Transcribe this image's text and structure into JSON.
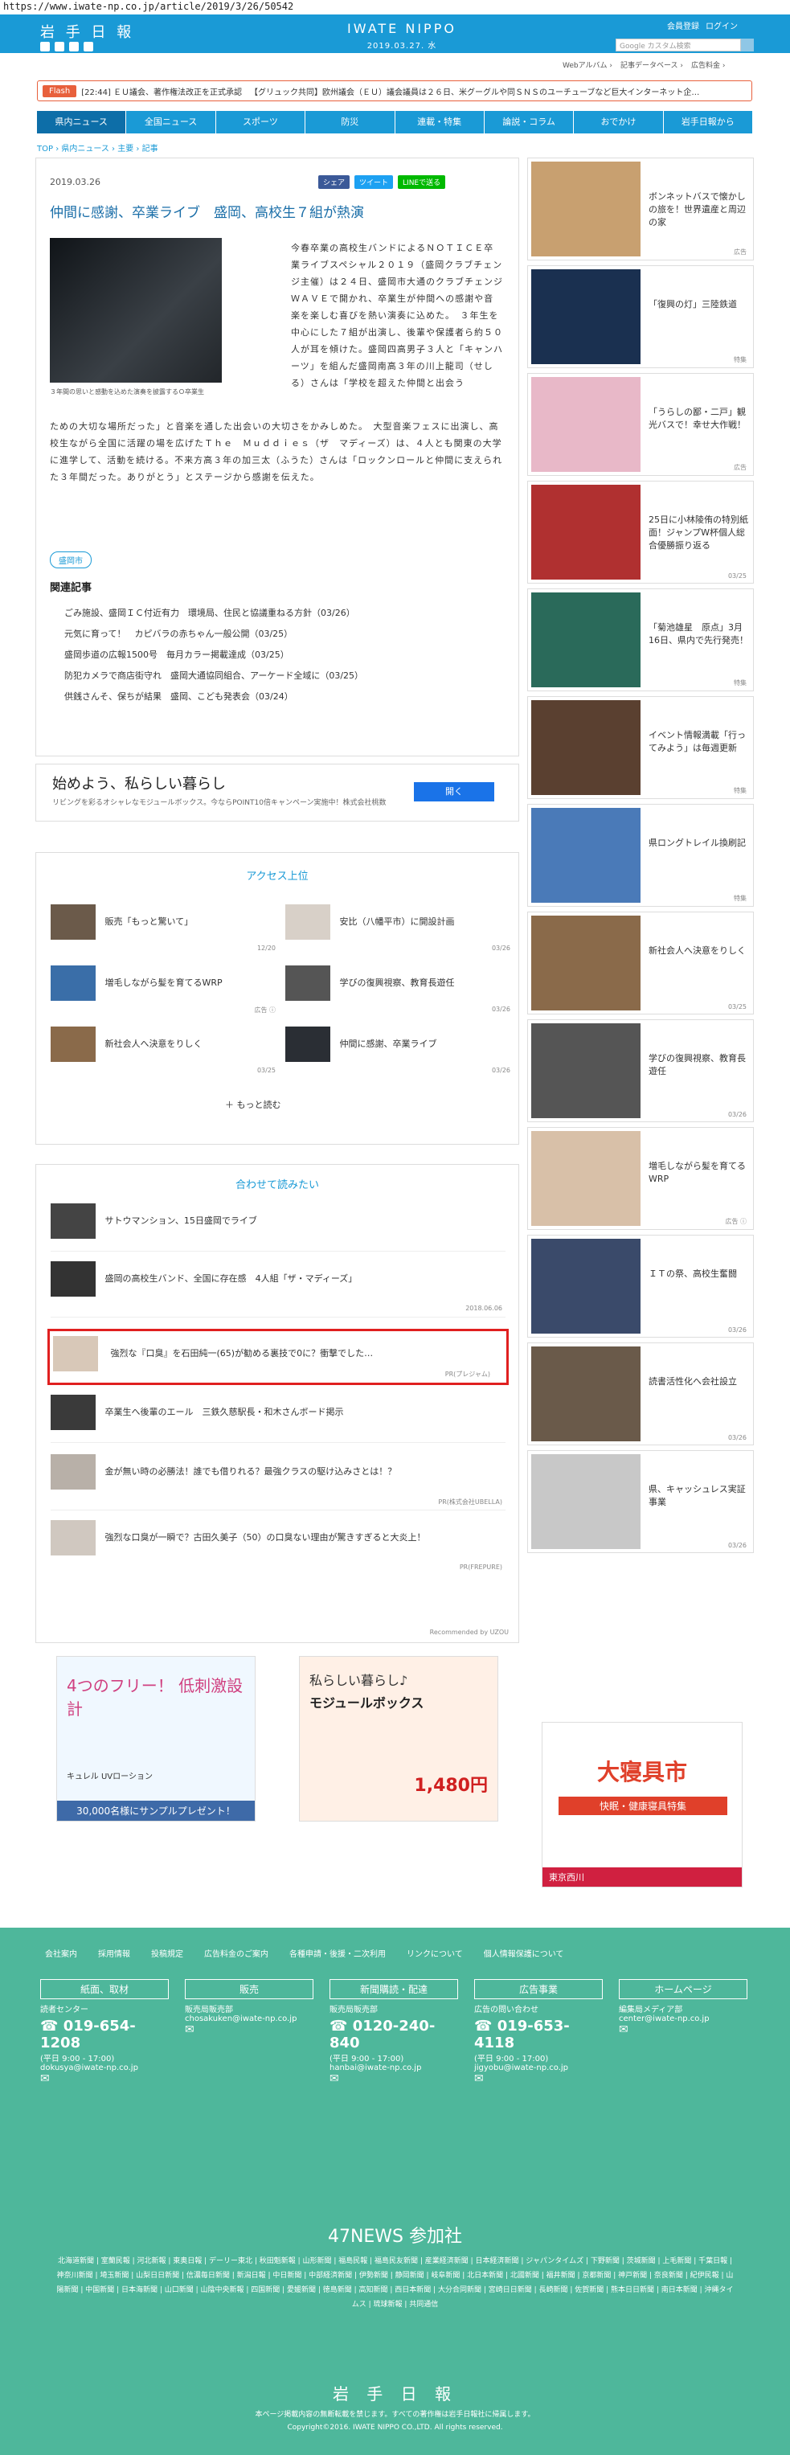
{
  "url": "https://www.iwate-np.co.jp/article/2019/3/26/50542",
  "header": {
    "logo": "岩 手 日 報",
    "brand": "IWATE NIPPO",
    "date": "2019.03.27. 水",
    "links": [
      "会員登録",
      "ログイン"
    ],
    "search_placeholder": "Google カスタム検索",
    "sublinks": [
      "Webアルバム ›",
      "記事データベース ›",
      "広告料金 ›"
    ]
  },
  "flash": {
    "label": "Flash",
    "items": [
      "[22:44] ＥＵ議会、著作権法改正を正式承認",
      "【グリュック共同】欧州議会（ＥＵ）議会議員は２６日、米グーグルや同ＳＮＳのユーチューブなど巨大インターネット企…"
    ]
  },
  "nav": [
    "県内ニュース",
    "全国ニュース",
    "スポーツ",
    "防災",
    "連載・特集",
    "論説・コラム",
    "おでかけ",
    "岩手日報から"
  ],
  "breadcrumb": "TOP › 県内ニュース › 主要 › 記事",
  "article": {
    "date": "2019.03.26",
    "share": [
      "シェア",
      "ツイート",
      "LINEで送る"
    ],
    "title": "仲間に感謝、卒業ライブ　盛岡、高校生７組が熱演",
    "caption": "３年間の思いと感動を込めた演奏を披露するＯ卒業生",
    "body1": "今春卒業の高校生バンドによるＮＯＴＩＣＥ卒業ライブスペシャル２０１９（盛岡クラブチェンジ主催）は２４日、盛岡市大通のクラブチェンジＷＡＶＥで開かれ、卒業生が仲間への感謝や音楽を楽しむ喜びを熱い演奏に込めた。　３年生を中心にした７組が出演し、後輩や保護者ら約５０人が耳を傾けた。盛岡四高男子３人と「キャンハーツ」を組んだ盛岡南高３年の川上龍司（せしる）さんは「学校を超えた仲間と出会う",
    "body2": "ための大切な場所だった」と音楽を通した出会いの大切さをかみしめた。　大型音楽フェスに出演し、高校生ながら全国に活躍の場を広げたＴｈｅ　Ｍｕｄｄｉｅｓ（ザ　マディーズ）は、４人とも関東の大学に進学して、活動を続ける。不来方高３年の加三太（ふうた）さんは「ロックンロールと仲間に支えられた３年間だった。ありがとう」とステージから感謝を伝えた。",
    "tag": "盛岡市",
    "related_heading": "関連記事",
    "related": [
      "ごみ施設、盛岡ＩＣ付近有力　環境局、住民と協議重ねる方針（03/26）",
      "元気に育って！　カピバラの赤ちゃん一般公開（03/25）",
      "盛岡歩道の広報1500号　毎月カラー掲載達成（03/25）",
      "防犯カメラで商店街守れ　盛岡大通協同組合、アーケード全域に（03/25）",
      "供銭さんそ、保ちが結果　盛岡、こども発表会（03/24）"
    ]
  },
  "google_ad": {
    "title": "始めよう、私らしい暮らし",
    "sub": "リビングを彩るオシャレなモジュールボックス。今ならPOINT10倍キャンペーン実施中！株式会社桃数",
    "button": "開く"
  },
  "access_ranking": {
    "heading": "アクセス上位",
    "items": [
      {
        "text": "販売「もっと驚いて」",
        "date": "12/20"
      },
      {
        "text": "安比（八幡平市）に開設計画",
        "date": "03/26"
      },
      {
        "text": "増毛しながら髪を育てるWRP",
        "date": "広告 ⓘ"
      },
      {
        "text": "学びの復興視察、教育長遊任",
        "date": "03/26"
      },
      {
        "text": "新社会人へ決意をりしく",
        "date": "03/25"
      },
      {
        "text": "仲間に感謝、卒業ライブ",
        "date": "03/26"
      }
    ],
    "more": "もっと読む"
  },
  "recommend": {
    "heading": "合わせて読みたい",
    "items": [
      {
        "text": "サトウマンション、15日盛岡でライブ",
        "date": ""
      },
      {
        "text": "盛岡の高校生バンド、全国に存在感　4人組「ザ・マディーズ」",
        "date": "2018.06.06"
      },
      {
        "text": "強烈な『口臭』を石田純一(65)が勧める裏技で0に？衝撃でした…",
        "date": "PR(プレジャム)"
      },
      {
        "text": "卒業生へ後輩のエール　三鉄久慈駅長・和木さんボード掲示",
        "date": ""
      },
      {
        "text": "金が無い時の必勝法！誰でも借りれる？最強クラスの駆け込みさとは！？",
        "date": "PR(株式会社UBELLA)"
      },
      {
        "text": "強烈な口臭が一瞬で？古田久美子（50）の口臭ない理由が驚きすぎると大炎上！",
        "date": "PR(FREPURE)"
      }
    ],
    "powered": "Recommended by UZOU"
  },
  "ads": {
    "ad1_title": "4つのフリー！ 低刺激設計",
    "ad1_sub": "キュレル UVローション",
    "ad1_cta": "30,000名様にサンプルプレゼント！",
    "ad2_title": "私らしい暮らし♪",
    "ad2_sub": "モジュールボックス",
    "ad2_price": "1,480円",
    "ad3_title": "大寝具市",
    "ad3_sub": "快眠・健康寝具特集",
    "ad3_store": "東京西川"
  },
  "sidebar": [
    {
      "text": "ボンネットバスで懐かしの旅を！世界遺産と周辺の家",
      "date": "広告"
    },
    {
      "text": "「復興の灯」三陸鉄道",
      "date": "特集"
    },
    {
      "text": "「うらしの鄙・二戸」観光バスで！幸せ大作戦！",
      "date": "広告"
    },
    {
      "text": "25日に小林陵侑の特別紙面！ジャンプW杯個人総合優勝振り返る",
      "date": "03/25"
    },
    {
      "text": "「菊池雄星　原点」3月16日、県内で先行発売！",
      "date": "特集"
    },
    {
      "text": "イベント情報満載「行ってみよう」は毎週更新",
      "date": "特集"
    },
    {
      "text": "県ロングトレイル換刷記",
      "date": "特集"
    },
    {
      "text": "新社会人へ決意をりしく",
      "date": "03/25"
    },
    {
      "text": "学びの復興視察、教育長遊任",
      "date": "03/26"
    },
    {
      "text": "増毛しながら髪を育てるWRP",
      "date": "広告 ⓘ"
    },
    {
      "text": "ＩＴの祭、高校生奮闘",
      "date": "03/26"
    },
    {
      "text": "読書活性化へ会社設立",
      "date": "03/26"
    },
    {
      "text": "県、キャッシュレス実証事業",
      "date": "03/26"
    }
  ],
  "footer": {
    "links": [
      "会社案内",
      "採用情報",
      "投稿規定",
      "広告料金のご案内",
      "各種申請・後援・二次利用",
      "リンクについて",
      "個人情報保護について"
    ],
    "cols": [
      {
        "h": "紙面、取材",
        "l1": "読者センター",
        "ph": "019-654-1208",
        "hours": "(平日 9:00 - 17:00)",
        "mail": "dokusya@iwate-np.co.jp"
      },
      {
        "h": "販売",
        "l1": "販売局販売部",
        "ph": "",
        "hours": "",
        "mail": "chosakuken@iwate-np.co.jp"
      },
      {
        "h": "新聞購読・配達",
        "l1": "販売局販売部",
        "ph": "0120-240-840",
        "hours": "(平日 9:00 - 17:00)",
        "mail": "hanbai@iwate-np.co.jp"
      },
      {
        "h": "広告事業",
        "l1": "広告の問い合わせ",
        "ph": "019-653-4118",
        "hours": "(平日 9:00 - 17:00)",
        "mail": "jigyobu@iwate-np.co.jp"
      },
      {
        "h": "ホームページ",
        "l1": "編集局メディア部",
        "ph": "",
        "hours": "",
        "mail": "center@iwate-np.co.jp"
      }
    ],
    "n47": "47NEWS 参加社",
    "papers": "北海道新聞 | 室蘭民報 | 河北新報 | 東奥日報 | デーリー東北 | 秋田魁新報 | 山形新聞 | 福島民報 | 福島民友新聞 | 産業経済新聞 | 日本経済新聞 | ジャパンタイムズ | 下野新聞 | 茨城新聞 | 上毛新聞 | 千葉日報 | 神奈川新聞 | 埼玉新聞 | 山梨日日新聞 | 信濃毎日新聞 | 新潟日報 | 中日新聞 | 中部経済新聞 | 伊勢新聞 | 静岡新聞 | 岐阜新聞 | 北日本新聞 | 北國新聞 | 福井新聞 | 京都新聞 | 神戸新聞 | 奈良新聞 | 紀伊民報 | 山陽新聞 | 中国新聞 | 日本海新聞 | 山口新聞 | 山陰中央新報 | 四国新聞 | 愛媛新聞 | 徳島新聞 | 高知新聞 | 西日本新聞 | 大分合同新聞 | 宮崎日日新聞 | 長崎新聞 | 佐賀新聞 | 熊本日日新聞 | 南日本新聞 | 沖縄タイムス | 琉球新報 | 共同通信",
    "logo": "岩 手 日 報",
    "copy1": "本ページ掲載内容の無断転載を禁じます。すべての著作権は岩手日報社に帰属します。",
    "copy2": "Copyright©2016. IWATE NIPPO CO.,LTD. All rights reserved."
  }
}
